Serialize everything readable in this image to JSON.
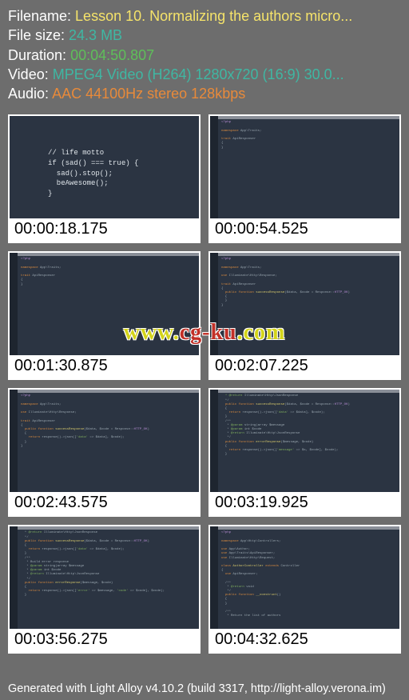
{
  "meta": {
    "filename_label": "Filename:",
    "filename_value": "Lesson 10. Normalizing the authors micro...",
    "filesize_label": "File size:",
    "filesize_value": "24.3 MB",
    "duration_label": "Duration:",
    "duration_value": "00:04:50.807",
    "video_label": "Video:",
    "video_value": "MPEG4 Video (H264) 1280x720 (16:9) 30.0...",
    "audio_label": "Audio:",
    "audio_value": "AAC 44100Hz stereo 128kbps"
  },
  "thumbnails": [
    {
      "timestamp": "00:00:18.175",
      "code": "// life motto\nif (sad() === true) {\n  sad().stop();\n  beAwesome();\n}",
      "style": "block"
    },
    {
      "timestamp": "00:00:54.525",
      "style": "editor"
    },
    {
      "timestamp": "00:01:30.875",
      "style": "editor"
    },
    {
      "timestamp": "00:02:07.225",
      "style": "editor"
    },
    {
      "timestamp": "00:02:43.575",
      "style": "editor"
    },
    {
      "timestamp": "00:03:19.925",
      "style": "editor"
    },
    {
      "timestamp": "00:03:56.275",
      "style": "editor"
    },
    {
      "timestamp": "00:04:32.625",
      "style": "editor"
    }
  ],
  "watermark": {
    "part1": "www.",
    "part2": "cg-ku",
    "part3": ".com"
  },
  "footer": "Generated with Light Alloy v4.10.2 (build 3317, http://light-alloy.verona.im)"
}
